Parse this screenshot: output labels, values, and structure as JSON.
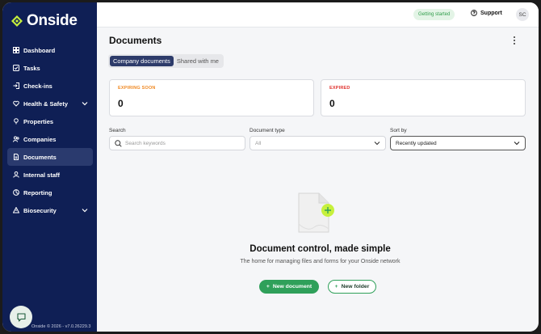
{
  "brand": {
    "name": "Onside",
    "accent": "#c6f03c",
    "sidebar_bg": "#0f1f55",
    "primary_green": "#2fa05a"
  },
  "sidebar": {
    "items": [
      {
        "label": "Dashboard",
        "icon": "dashboard-icon"
      },
      {
        "label": "Tasks",
        "icon": "tasks-icon"
      },
      {
        "label": "Check-ins",
        "icon": "check-in-icon"
      },
      {
        "label": "Health & Safety",
        "icon": "heart-icon"
      },
      {
        "label": "Properties",
        "icon": "properties-icon"
      },
      {
        "label": "Companies",
        "icon": "companies-icon"
      },
      {
        "label": "Documents",
        "icon": "document-icon"
      },
      {
        "label": "Internal staff",
        "icon": "person-icon"
      },
      {
        "label": "Reporting",
        "icon": "reporting-icon"
      },
      {
        "label": "Biosecurity",
        "icon": "biosecurity-icon"
      }
    ],
    "active": "Documents",
    "footer": "Onside © 2026 - v7.0.26229.3"
  },
  "topbar": {
    "getting_started": "Getting started",
    "support": "Support",
    "avatar_initials": "SC"
  },
  "page": {
    "title": "Documents",
    "tabs": [
      {
        "label": "Company documents"
      },
      {
        "label": "Shared with me"
      }
    ],
    "active_tab": "Company documents"
  },
  "cards": {
    "expiring": {
      "label": "EXPIRING SOON",
      "value": "0",
      "color": "#f08a24"
    },
    "expired": {
      "label": "EXPIRED",
      "value": "0",
      "color": "#e0332f"
    }
  },
  "filters": {
    "search": {
      "label": "Search",
      "placeholder": "Search keywords"
    },
    "doc_type": {
      "label": "Document type",
      "value": "All"
    },
    "sort": {
      "label": "Sort by",
      "value": "Recently updated"
    }
  },
  "empty_state": {
    "title": "Document control, made simple",
    "subtitle": "The home for managing files and forms for your Onside network",
    "new_document": "New document",
    "new_folder": "New folder"
  }
}
